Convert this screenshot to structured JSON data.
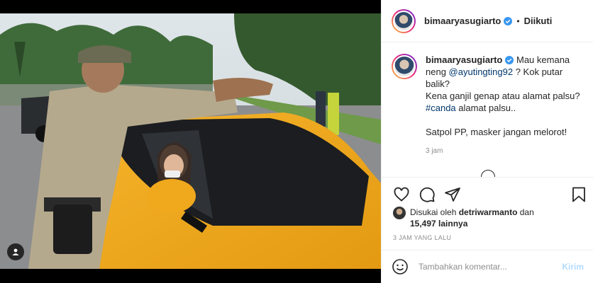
{
  "header": {
    "username": "bimaaryasugiarto",
    "separator": "•",
    "follow_status": "Diikuti"
  },
  "caption": {
    "username": "bimaaryasugiarto",
    "line1_text": "Mau kemana",
    "line2_prefix": "neng",
    "mention": "@ayutingting92",
    "line2_suffix": "? Kok putar",
    "line3": "balik?",
    "line4": "Kena ganjil genap atau alamat palsu?",
    "hashtag": "#canda",
    "line5_suffix": "alamat palsu..",
    "line6": "Satpol PP, masker jangan melorot!",
    "time": "3 jam"
  },
  "likes": {
    "prefix": "Disukai oleh",
    "liker": "detriwarmanto",
    "middle": "dan",
    "others": "15,497 lainnya"
  },
  "post_time": "3 JAM YANG LALU",
  "comment_box": {
    "placeholder": "Tambahkan komentar...",
    "post_label": "Kirim"
  },
  "icons": {
    "like": "heart-icon",
    "comment": "comment-icon",
    "share": "share-icon",
    "save": "bookmark-icon",
    "emoji": "emoji-icon",
    "tags": "user-tag-icon",
    "verified": "verified-badge-icon"
  },
  "colors": {
    "link": "#00376b",
    "verified": "#3897f0",
    "post_button_disabled": "#b3dbff",
    "muted": "#8e8e8e"
  }
}
